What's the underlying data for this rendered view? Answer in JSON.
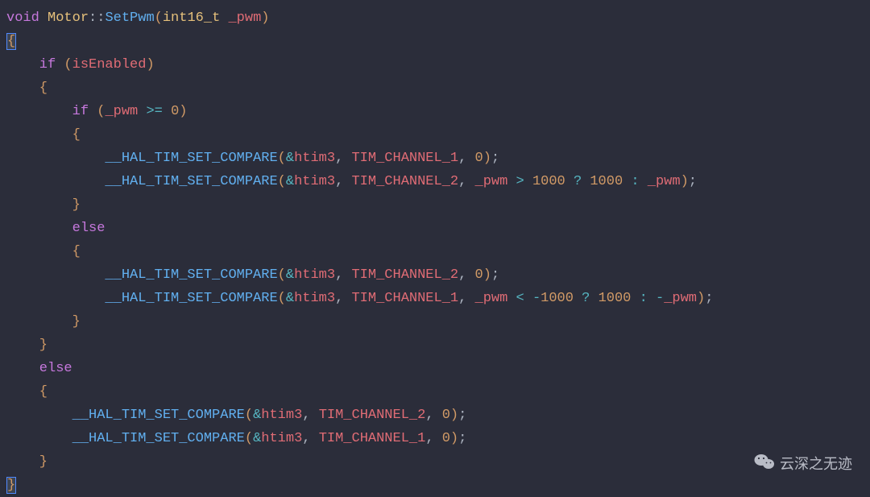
{
  "code": {
    "line1_void": "void",
    "line1_class": "Motor",
    "line1_scope": "::",
    "line1_func": "SetPwm",
    "line1_lparen": "(",
    "line1_type": "int16_t",
    "line1_param": " _pwm",
    "line1_rparen": ")",
    "line2_brace": "{",
    "line3_if": "    if",
    "line3_paren_l": " (",
    "line3_ident": "isEnabled",
    "line3_paren_r": ")",
    "line4_brace": "    {",
    "line5_if": "        if",
    "line5_paren_l": " (",
    "line5_ident": "_pwm",
    "line5_op": " >= ",
    "line5_num": "0",
    "line5_paren_r": ")",
    "line6_brace": "        {",
    "line7_macro": "            __HAL_TIM_SET_COMPARE",
    "line7_paren_l": "(",
    "line7_amp": "&",
    "line7_var": "htim3",
    "line7_comma1": ", ",
    "line7_const": "TIM_CHANNEL_1",
    "line7_comma2": ", ",
    "line7_num": "0",
    "line7_paren_r": ")",
    "line7_semi": ";",
    "line8_macro": "            __HAL_TIM_SET_COMPARE",
    "line8_paren_l": "(",
    "line8_amp": "&",
    "line8_var": "htim3",
    "line8_comma1": ", ",
    "line8_const": "TIM_CHANNEL_2",
    "line8_comma2": ", ",
    "line8_ident": "_pwm",
    "line8_op1": " > ",
    "line8_num1": "1000",
    "line8_op2": " ? ",
    "line8_num2": "1000",
    "line8_op3": " : ",
    "line8_ident2": "_pwm",
    "line8_paren_r": ")",
    "line8_semi": ";",
    "line9_brace": "        }",
    "line10_else": "        else",
    "line11_brace": "        {",
    "line12_macro": "            __HAL_TIM_SET_COMPARE",
    "line12_paren_l": "(",
    "line12_amp": "&",
    "line12_var": "htim3",
    "line12_comma1": ", ",
    "line12_const": "TIM_CHANNEL_2",
    "line12_comma2": ", ",
    "line12_num": "0",
    "line12_paren_r": ")",
    "line12_semi": ";",
    "line13_macro": "            __HAL_TIM_SET_COMPARE",
    "line13_paren_l": "(",
    "line13_amp": "&",
    "line13_var": "htim3",
    "line13_comma1": ", ",
    "line13_const": "TIM_CHANNEL_1",
    "line13_comma2": ", ",
    "line13_ident": "_pwm",
    "line13_op1": " < ",
    "line13_neg": "-",
    "line13_num1": "1000",
    "line13_op2": " ? ",
    "line13_num2": "1000",
    "line13_op3": " : ",
    "line13_neg2": "-",
    "line13_ident2": "_pwm",
    "line13_paren_r": ")",
    "line13_semi": ";",
    "line14_brace": "        }",
    "line15_brace": "    }",
    "line16_else": "    else",
    "line17_brace": "    {",
    "line18_macro": "        __HAL_TIM_SET_COMPARE",
    "line18_paren_l": "(",
    "line18_amp": "&",
    "line18_var": "htim3",
    "line18_comma1": ", ",
    "line18_const": "TIM_CHANNEL_2",
    "line18_comma2": ", ",
    "line18_num": "0",
    "line18_paren_r": ")",
    "line18_semi": ";",
    "line19_macro": "        __HAL_TIM_SET_COMPARE",
    "line19_paren_l": "(",
    "line19_amp": "&",
    "line19_var": "htim3",
    "line19_comma1": ", ",
    "line19_const": "TIM_CHANNEL_1",
    "line19_comma2": ", ",
    "line19_num": "0",
    "line19_paren_r": ")",
    "line19_semi": ";",
    "line20_brace": "    }",
    "line21_brace": "}"
  },
  "watermark": {
    "text": "云深之无迹"
  }
}
